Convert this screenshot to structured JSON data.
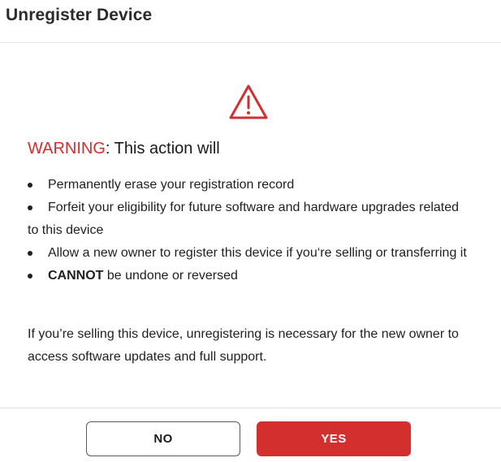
{
  "dialog": {
    "title": "Unregister Device"
  },
  "warning": {
    "icon": "warning-triangle-icon",
    "label": "WARNING",
    "rest": ": This action will",
    "color": "#d32f2f"
  },
  "items": [
    {
      "strong": "",
      "text": "Permanently erase your registration record"
    },
    {
      "strong": "",
      "text": "Forfeit your eligibility for future software and hardware upgrades related to this device"
    },
    {
      "strong": "",
      "text": "Allow a new owner to register this device if you‘re selling or transferring it"
    },
    {
      "strong": "CANNOT",
      "text": " be undone or reversed"
    }
  ],
  "note": "If you’re selling this device, unregistering is necessary for the new owner to access software updates and full support.",
  "buttons": {
    "no_label": "NO",
    "yes_label": "YES",
    "yes_color": "#d32f2f"
  }
}
